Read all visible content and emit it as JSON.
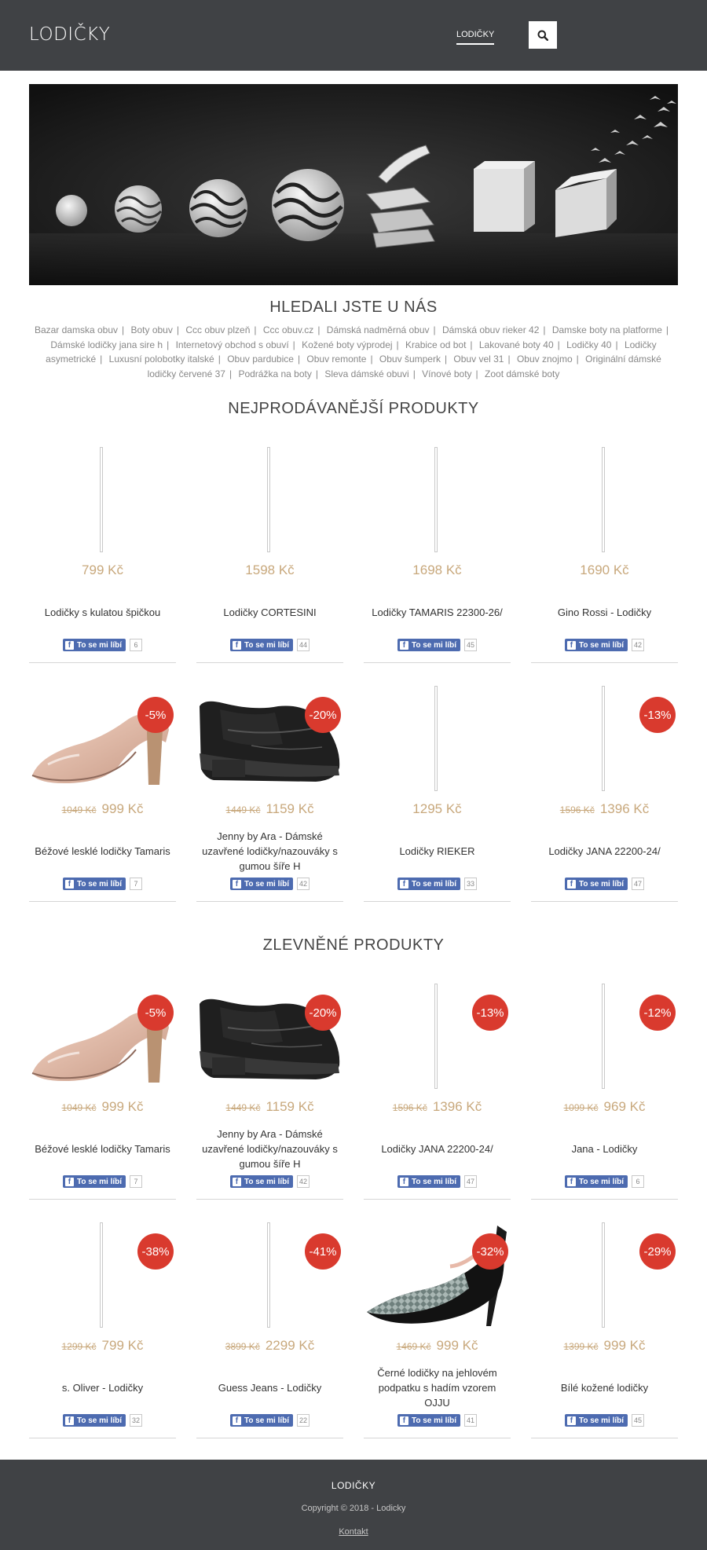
{
  "header": {
    "logo": "LODIČKY",
    "nav_label": "LODIČKY"
  },
  "search_section": {
    "title": "HLEDALI JSTE U NÁS",
    "terms": [
      "Bazar damska obuv",
      "Boty obuv",
      "Ccc obuv plzeň",
      "Ccc obuv.cz",
      "Dámská nadměrná obuv",
      "Dámská obuv rieker 42",
      "Damske boty na platforme",
      "Dámské lodičky jana sire h",
      "Internetový obchod s obuví",
      "Kožené boty výprodej",
      "Krabice od bot",
      "Lakované boty 40",
      "Lodičky 40",
      "Lodičky asymetrické",
      "Luxusní polobotky italské",
      "Obuv pardubice",
      "Obuv remonte",
      "Obuv šumperk",
      "Obuv vel 31",
      "Obuv znojmo",
      "Originální dámské lodičky červené 37",
      "Podrážka na boty",
      "Sleva dámské obuvi",
      "Vínové boty",
      "Zoot dámské boty"
    ]
  },
  "bestsellers": {
    "title": "NEJPRODÁVANĚJŠÍ PRODUKTY",
    "products": [
      {
        "image": "placeholder",
        "badge": "",
        "old_price": "",
        "price": "799 Kč",
        "name": "Lodičky s kulatou špičkou",
        "fb_label": "To se mi líbí",
        "fb_count": "6"
      },
      {
        "image": "placeholder",
        "badge": "",
        "old_price": "",
        "price": "1598 Kč",
        "name": "Lodičky CORTESINI",
        "fb_label": "To se mi líbí",
        "fb_count": "44"
      },
      {
        "image": "placeholder",
        "badge": "",
        "old_price": "",
        "price": "1698 Kč",
        "name": "Lodičky TAMARIS 22300-26/",
        "fb_label": "To se mi líbí",
        "fb_count": "45"
      },
      {
        "image": "placeholder",
        "badge": "",
        "old_price": "",
        "price": "1690 Kč",
        "name": "Gino Rossi - Lodičky",
        "fb_label": "To se mi líbí",
        "fb_count": "42"
      },
      {
        "image": "nude-pump",
        "badge": "-5%",
        "old_price": "1049 Kč",
        "price": "999 Kč",
        "name": "Béžové lesklé lodičky Tamaris",
        "fb_label": "To se mi líbí",
        "fb_count": "7"
      },
      {
        "image": "black-shoe",
        "badge": "-20%",
        "old_price": "1449 Kč",
        "price": "1159 Kč",
        "name": "Jenny by Ara - Dámské uzavřené lodičky/nazouváky s gumou šíře H",
        "fb_label": "To se mi líbí",
        "fb_count": "42"
      },
      {
        "image": "placeholder",
        "badge": "",
        "old_price": "",
        "price": "1295 Kč",
        "name": "Lodičky RIEKER",
        "fb_label": "To se mi líbí",
        "fb_count": "33"
      },
      {
        "image": "placeholder",
        "badge": "-13%",
        "old_price": "1596 Kč",
        "price": "1396 Kč",
        "name": "Lodičky JANA 22200-24/",
        "fb_label": "To se mi líbí",
        "fb_count": "47"
      }
    ]
  },
  "discounted": {
    "title": "ZLEVNĚNÉ PRODUKTY",
    "products": [
      {
        "image": "nude-pump",
        "badge": "-5%",
        "old_price": "1049 Kč",
        "price": "999 Kč",
        "name": "Béžové lesklé lodičky Tamaris",
        "fb_label": "To se mi líbí",
        "fb_count": "7"
      },
      {
        "image": "black-shoe",
        "badge": "-20%",
        "old_price": "1449 Kč",
        "price": "1159 Kč",
        "name": "Jenny by Ara - Dámské uzavřené lodičky/nazouváky s gumou šíře H",
        "fb_label": "To se mi líbí",
        "fb_count": "42"
      },
      {
        "image": "placeholder",
        "badge": "-13%",
        "old_price": "1596 Kč",
        "price": "1396 Kč",
        "name": "Lodičky JANA 22200-24/",
        "fb_label": "To se mi líbí",
        "fb_count": "47"
      },
      {
        "image": "placeholder",
        "badge": "-12%",
        "old_price": "1099 Kč",
        "price": "969 Kč",
        "name": "Jana - Lodičky",
        "fb_label": "To se mi líbí",
        "fb_count": "6"
      },
      {
        "image": "placeholder",
        "badge": "-38%",
        "old_price": "1299 Kč",
        "price": "799 Kč",
        "name": "s. Oliver - Lodičky",
        "fb_label": "To se mi líbí",
        "fb_count": "32"
      },
      {
        "image": "placeholder",
        "badge": "-41%",
        "old_price": "3899 Kč",
        "price": "2299 Kč",
        "name": "Guess Jeans - Lodičky",
        "fb_label": "To se mi líbí",
        "fb_count": "22"
      },
      {
        "image": "snake-heel",
        "badge": "-32%",
        "old_price": "1469 Kč",
        "price": "999 Kč",
        "name": "Černé lodičky na jehlovém podpatku s hadím vzorem OJJU",
        "fb_label": "To se mi líbí",
        "fb_count": "41"
      },
      {
        "image": "placeholder",
        "badge": "-29%",
        "old_price": "1399 Kč",
        "price": "999 Kč",
        "name": "Bílé kožené lodičky",
        "fb_label": "To se mi líbí",
        "fb_count": "45"
      }
    ]
  },
  "footer": {
    "title": "LODIČKY",
    "copyright": "Copyright © 2018 - Lodicky",
    "contact_link": "Kontakt"
  },
  "colors": {
    "header_bg": "#404245",
    "price": "#c8a87c",
    "badge": "#d93a2e",
    "facebook": "#4d6bb0"
  },
  "icons": {
    "search": "search-icon",
    "facebook": "facebook-icon"
  }
}
